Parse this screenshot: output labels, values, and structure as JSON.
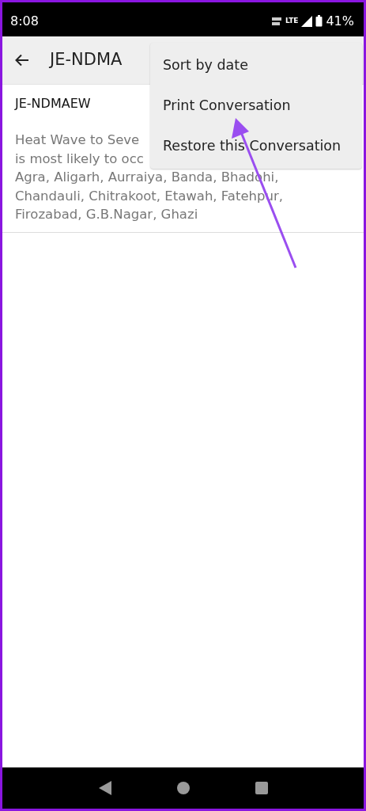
{
  "status_bar": {
    "time": "8:08",
    "network": "LTE",
    "battery": "41%"
  },
  "app_bar": {
    "title": "JE-NDMA"
  },
  "conversation": {
    "sender": "JE-NDMAEW",
    "message_lines": [
      "Heat Wave to Seve",
      "is most likely to occ",
      "Agra, Aligarh, Aurraiya, Banda, Bhadohi,",
      "Chandauli, Chitrakoot, Etawah, Fatehpur,",
      "Firozabad, G.B.Nagar, Ghazi"
    ]
  },
  "menu": {
    "items": [
      {
        "label": "Sort by date"
      },
      {
        "label": "Print Conversation"
      },
      {
        "label": "Restore this Conversation"
      }
    ]
  }
}
